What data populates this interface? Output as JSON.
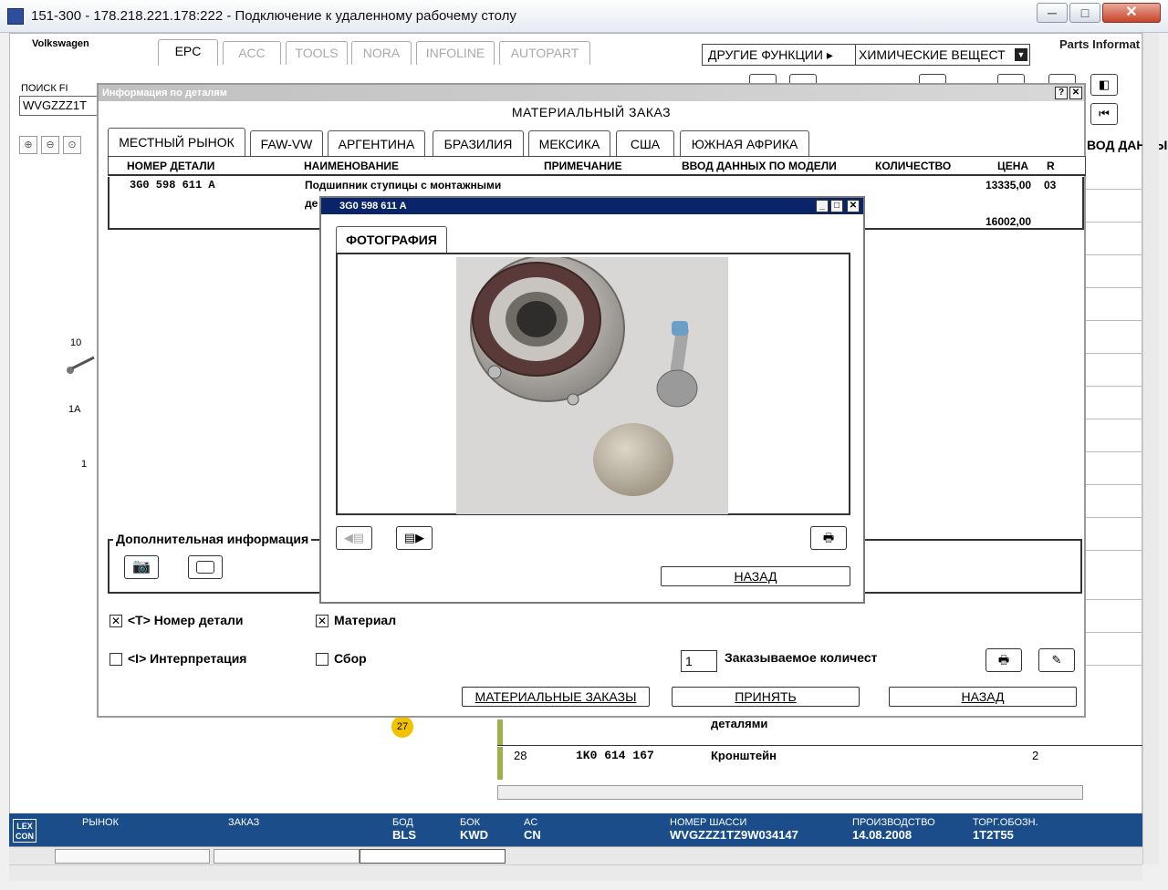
{
  "window": {
    "title": "151-300 - 178.218.221.178:222 - Подключение к удаленному рабочему столу",
    "min": "─",
    "max": "□",
    "close": "✕"
  },
  "app": {
    "brand": "Volkswagen",
    "tabs": [
      "EPC",
      "ACC",
      "TOOLS",
      "NORA",
      "INFOLINE",
      "AUTOPART"
    ],
    "other_functions": "ДРУГИЕ ФУНКЦИИ ▸",
    "chem_select": "ХИМИЧЕСКИЕ ВЕЩЕСТ",
    "parts_info": "Parts Informat",
    "search_label": "ПОИСК FI",
    "search_value": "WVGZZZ1T",
    "right_header": "ВОД ДАННЫ",
    "diagram_labels": [
      "10",
      "1A",
      "1"
    ],
    "callout": "27"
  },
  "background_rows": [
    {
      "text": "деталями"
    },
    {
      "num": "28",
      "part": "1K0 614 167",
      "name": "Кронштейн",
      "qty": "2"
    }
  ],
  "status": {
    "logo": "LEX CON",
    "fields": [
      {
        "label": "РЫНОК",
        "value": ""
      },
      {
        "label": "ЗАКАЗ",
        "value": ""
      },
      {
        "label": "БОД",
        "value": "BLS"
      },
      {
        "label": "БОК",
        "value": "KWD"
      },
      {
        "label": "AC",
        "value": "CN"
      },
      {
        "label": "НОМЕР ШАССИ",
        "value": "WVGZZZ1TZ9W034147"
      },
      {
        "label": "ПРОИЗВОДСТВО",
        "value": "14.08.2008"
      },
      {
        "label": "ТОРГ.ОБОЗН.",
        "value": "1T2T55"
      }
    ]
  },
  "dialog": {
    "title": "Информация по деталям",
    "heading": "МАТЕРИАЛЬНЫЙ ЗАКАЗ",
    "help": "?",
    "close": "✕",
    "tabs": [
      "МЕСТНЫЙ РЫНОК",
      "FAW-VW",
      "АРГЕНТИНА",
      "БРАЗИЛИЯ",
      "МЕКСИКА",
      "США",
      "ЮЖНАЯ АФРИКА"
    ],
    "columns": [
      "НОМЕР ДЕТАЛИ",
      "НАИМЕНОВАНИЕ",
      "ПРИМЕЧАНИЕ",
      "ВВОД ДАННЫХ ПО МОДЕЛИ",
      "КОЛИЧЕСТВО",
      "ЦЕНА",
      "R"
    ],
    "row": {
      "part": "3G0 598 611 A",
      "name": "Подшипник ступицы с монтажными",
      "name2": "де",
      "price": "13335,00",
      "price2": "16002,00",
      "r": "03"
    },
    "addinfo_label": "Дополнительная информация",
    "chk_part": "<T> Номер детали",
    "chk_material": "Материал",
    "chk_interp": "<I> Интерпретация",
    "chk_assembly": "Сбор",
    "qty_value": "1",
    "qty_label": "Заказываемое количест",
    "btn_orders": "МАТЕРИАЛЬНЫЕ ЗАКАЗЫ",
    "btn_accept": "ПРИНЯТЬ",
    "btn_back": "НАЗАД"
  },
  "photo": {
    "title": "3G0 598 611 A",
    "tab": "ФОТОГРАФИЯ",
    "back": "НАЗАД"
  }
}
